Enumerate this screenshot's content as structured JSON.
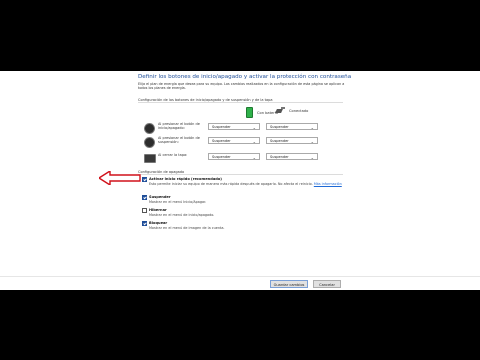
{
  "window": {
    "title": "Definir los botones de inicio/apagado y activar la protección con contraseña",
    "description": "Elija el plan de energía que desea para su equipo. Los cambios realizados en la configuración de esta página se aplican a todos los planes de energía."
  },
  "buttons_section": {
    "heading": "Configuración de los botones de inicio/apagado y de suspensión y de la tapa",
    "columns": {
      "battery": "Con batería",
      "plugged": "Conectado"
    },
    "rows": [
      {
        "icon": "power-button-icon",
        "label": "Al presionar el botón de inicio/apagado:",
        "battery": "Suspender",
        "plugged": "Suspender"
      },
      {
        "icon": "sleep-button-icon",
        "label": "Al presionar el botón de suspensión:",
        "battery": "Suspender",
        "plugged": "Suspender"
      },
      {
        "icon": "lid-icon",
        "label": "Al cerrar la tapa:",
        "battery": "Suspender",
        "plugged": "Suspender"
      }
    ]
  },
  "shutdown_section": {
    "heading": "Configuración de apagado",
    "options": [
      {
        "label": "Activar inicio rápido (recomendado)",
        "checked": true,
        "description": "Esto permite iniciar su equipo de manera más rápida después de apagarlo. No afecta el reinicio.",
        "link": "Más información"
      },
      {
        "label": "Suspender",
        "checked": true,
        "description": "Mostrar en el menú Inicio/Apagar."
      },
      {
        "label": "Hibernar",
        "checked": false,
        "description": "Mostrar en el menú de inicio/apagado."
      },
      {
        "label": "Bloquear",
        "checked": true,
        "description": "Mostrar en el menú de imagen de la cuenta."
      }
    ]
  },
  "footer": {
    "save_label": "Guardar cambios",
    "cancel_label": "Cancelar"
  },
  "colors": {
    "title": "#1f4e99",
    "arrow": "#d0101a",
    "checkbox": "#1f4e99"
  }
}
